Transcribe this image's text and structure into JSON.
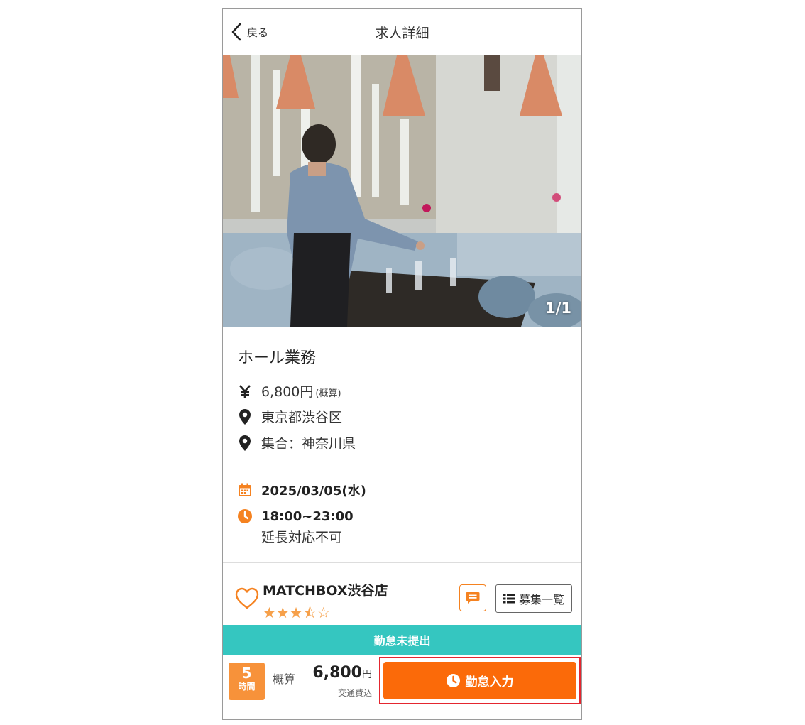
{
  "header": {
    "back_label": "戻る",
    "title": "求人詳細"
  },
  "photo": {
    "counter": "1/1"
  },
  "job": {
    "title": "ホール業務",
    "wage": "6,800円",
    "wage_note": "(概算)",
    "location": "東京都渋谷区",
    "meeting_point": "集合：神奈川県"
  },
  "schedule": {
    "date": "2025/03/05(水)",
    "time": "18:00~23:00",
    "extension_note": "延長対応不可"
  },
  "store": {
    "name": "MATCHBOX渋谷店",
    "rating_stars": "★★★⯪☆",
    "rating_value": 3.5,
    "list_button_label": "募集一覧"
  },
  "status": {
    "label": "勤怠未提出"
  },
  "footer": {
    "hours_value": "5",
    "hours_unit": "時間",
    "estimate_label": "概算",
    "estimate_amount": "6,800",
    "estimate_currency": "円",
    "estimate_note": "交通費込",
    "submit_label": "勤怠入力"
  },
  "colors": {
    "accent_orange": "#fb6a09",
    "status_teal": "#35c6c0",
    "hours_badge": "#f7923a",
    "highlight_red": "#e4262f"
  }
}
